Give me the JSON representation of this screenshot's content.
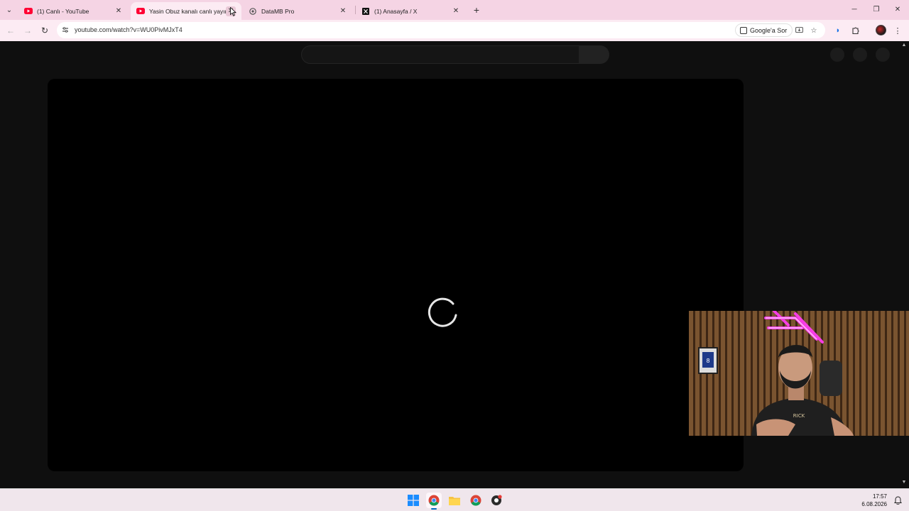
{
  "browser": {
    "tabs": [
      {
        "title": "(1) Canlı - YouTube",
        "icon": "youtube-icon",
        "active": false
      },
      {
        "title": "Yasin Obuz kanalı canlı yayında",
        "icon": "youtube-icon",
        "active": true
      },
      {
        "title": "DataMB Pro",
        "icon": "datamb-icon",
        "active": false
      },
      {
        "title": "(1) Anasayfa / X",
        "icon": "x-icon",
        "active": false
      }
    ],
    "new_tab": "+",
    "close_glyph": "✕",
    "url": "youtube.com/watch?v=WU0PivMJxT4",
    "google_ask": "Google'a Sor",
    "window_controls": {
      "minimize": "─",
      "maximize": "❐",
      "close": "✕"
    }
  },
  "taskbar": {
    "time": "17:57",
    "date": "6.08.2026"
  },
  "colors": {
    "youtube_red": "#ff0033",
    "tab_bar": "#f5d4e4",
    "toolbar": "#fcebf3",
    "page_bg": "#0f0f0f"
  }
}
